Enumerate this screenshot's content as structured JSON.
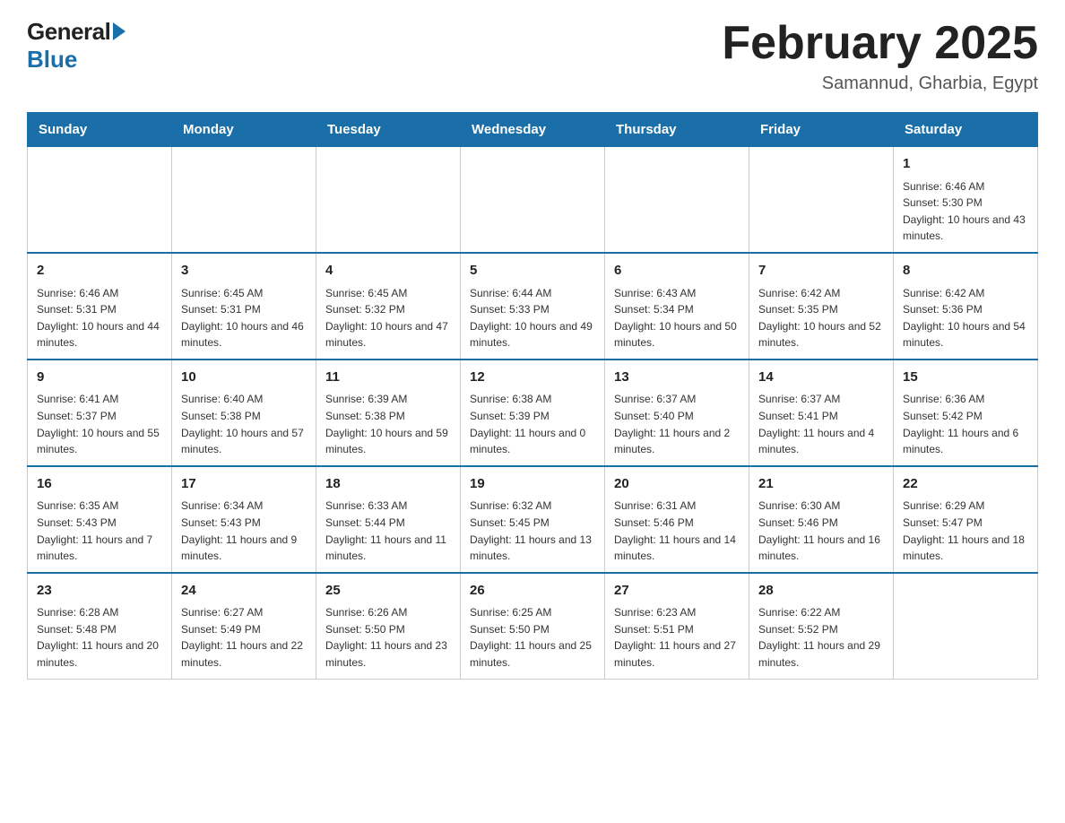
{
  "header": {
    "logo": {
      "general": "General",
      "blue": "Blue"
    },
    "title": "February 2025",
    "subtitle": "Samannud, Gharbia, Egypt"
  },
  "days_of_week": [
    "Sunday",
    "Monday",
    "Tuesday",
    "Wednesday",
    "Thursday",
    "Friday",
    "Saturday"
  ],
  "weeks": [
    [
      {
        "day": "",
        "info": ""
      },
      {
        "day": "",
        "info": ""
      },
      {
        "day": "",
        "info": ""
      },
      {
        "day": "",
        "info": ""
      },
      {
        "day": "",
        "info": ""
      },
      {
        "day": "",
        "info": ""
      },
      {
        "day": "1",
        "info": "Sunrise: 6:46 AM\nSunset: 5:30 PM\nDaylight: 10 hours and 43 minutes."
      }
    ],
    [
      {
        "day": "2",
        "info": "Sunrise: 6:46 AM\nSunset: 5:31 PM\nDaylight: 10 hours and 44 minutes."
      },
      {
        "day": "3",
        "info": "Sunrise: 6:45 AM\nSunset: 5:31 PM\nDaylight: 10 hours and 46 minutes."
      },
      {
        "day": "4",
        "info": "Sunrise: 6:45 AM\nSunset: 5:32 PM\nDaylight: 10 hours and 47 minutes."
      },
      {
        "day": "5",
        "info": "Sunrise: 6:44 AM\nSunset: 5:33 PM\nDaylight: 10 hours and 49 minutes."
      },
      {
        "day": "6",
        "info": "Sunrise: 6:43 AM\nSunset: 5:34 PM\nDaylight: 10 hours and 50 minutes."
      },
      {
        "day": "7",
        "info": "Sunrise: 6:42 AM\nSunset: 5:35 PM\nDaylight: 10 hours and 52 minutes."
      },
      {
        "day": "8",
        "info": "Sunrise: 6:42 AM\nSunset: 5:36 PM\nDaylight: 10 hours and 54 minutes."
      }
    ],
    [
      {
        "day": "9",
        "info": "Sunrise: 6:41 AM\nSunset: 5:37 PM\nDaylight: 10 hours and 55 minutes."
      },
      {
        "day": "10",
        "info": "Sunrise: 6:40 AM\nSunset: 5:38 PM\nDaylight: 10 hours and 57 minutes."
      },
      {
        "day": "11",
        "info": "Sunrise: 6:39 AM\nSunset: 5:38 PM\nDaylight: 10 hours and 59 minutes."
      },
      {
        "day": "12",
        "info": "Sunrise: 6:38 AM\nSunset: 5:39 PM\nDaylight: 11 hours and 0 minutes."
      },
      {
        "day": "13",
        "info": "Sunrise: 6:37 AM\nSunset: 5:40 PM\nDaylight: 11 hours and 2 minutes."
      },
      {
        "day": "14",
        "info": "Sunrise: 6:37 AM\nSunset: 5:41 PM\nDaylight: 11 hours and 4 minutes."
      },
      {
        "day": "15",
        "info": "Sunrise: 6:36 AM\nSunset: 5:42 PM\nDaylight: 11 hours and 6 minutes."
      }
    ],
    [
      {
        "day": "16",
        "info": "Sunrise: 6:35 AM\nSunset: 5:43 PM\nDaylight: 11 hours and 7 minutes."
      },
      {
        "day": "17",
        "info": "Sunrise: 6:34 AM\nSunset: 5:43 PM\nDaylight: 11 hours and 9 minutes."
      },
      {
        "day": "18",
        "info": "Sunrise: 6:33 AM\nSunset: 5:44 PM\nDaylight: 11 hours and 11 minutes."
      },
      {
        "day": "19",
        "info": "Sunrise: 6:32 AM\nSunset: 5:45 PM\nDaylight: 11 hours and 13 minutes."
      },
      {
        "day": "20",
        "info": "Sunrise: 6:31 AM\nSunset: 5:46 PM\nDaylight: 11 hours and 14 minutes."
      },
      {
        "day": "21",
        "info": "Sunrise: 6:30 AM\nSunset: 5:46 PM\nDaylight: 11 hours and 16 minutes."
      },
      {
        "day": "22",
        "info": "Sunrise: 6:29 AM\nSunset: 5:47 PM\nDaylight: 11 hours and 18 minutes."
      }
    ],
    [
      {
        "day": "23",
        "info": "Sunrise: 6:28 AM\nSunset: 5:48 PM\nDaylight: 11 hours and 20 minutes."
      },
      {
        "day": "24",
        "info": "Sunrise: 6:27 AM\nSunset: 5:49 PM\nDaylight: 11 hours and 22 minutes."
      },
      {
        "day": "25",
        "info": "Sunrise: 6:26 AM\nSunset: 5:50 PM\nDaylight: 11 hours and 23 minutes."
      },
      {
        "day": "26",
        "info": "Sunrise: 6:25 AM\nSunset: 5:50 PM\nDaylight: 11 hours and 25 minutes."
      },
      {
        "day": "27",
        "info": "Sunrise: 6:23 AM\nSunset: 5:51 PM\nDaylight: 11 hours and 27 minutes."
      },
      {
        "day": "28",
        "info": "Sunrise: 6:22 AM\nSunset: 5:52 PM\nDaylight: 11 hours and 29 minutes."
      },
      {
        "day": "",
        "info": ""
      }
    ]
  ]
}
